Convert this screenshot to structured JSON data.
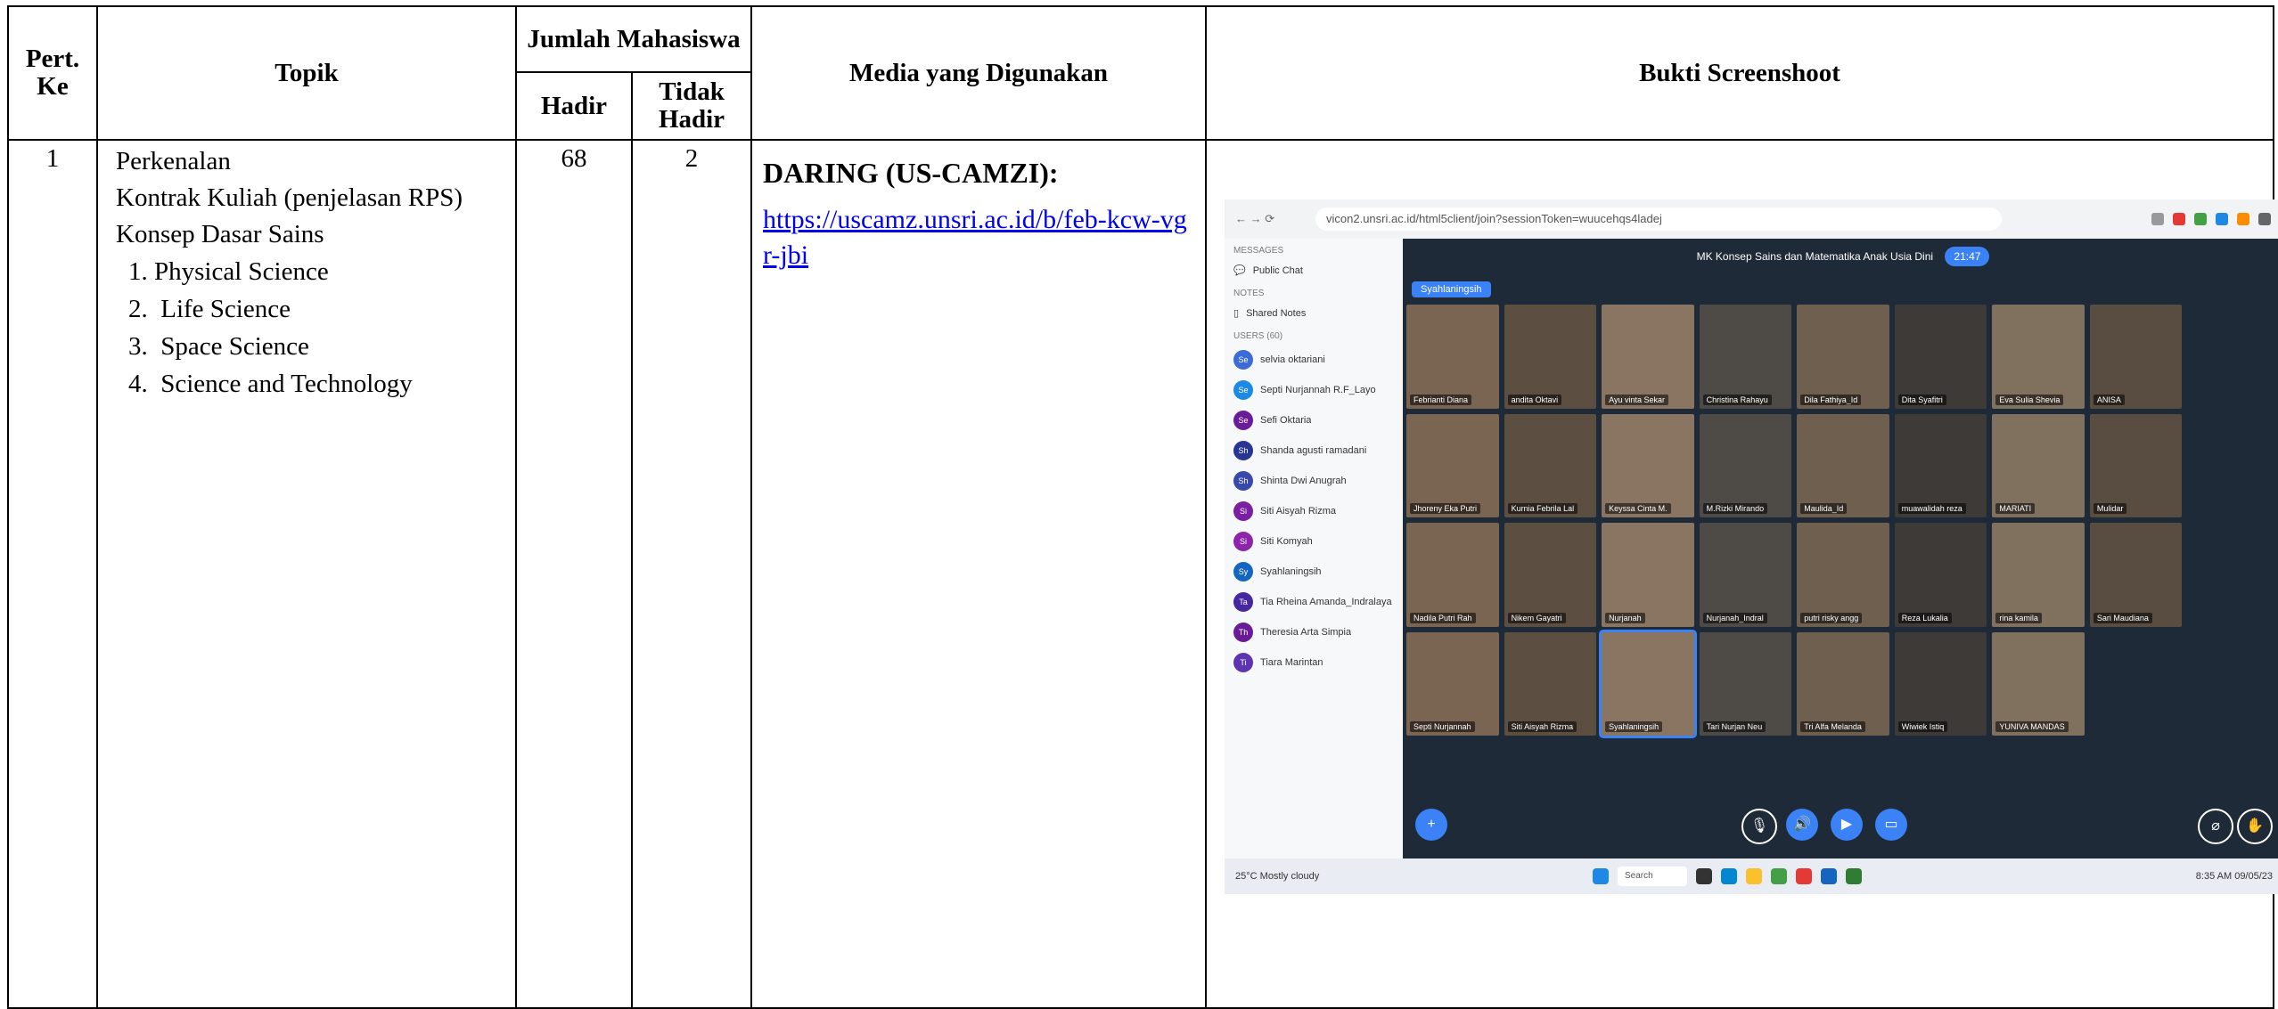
{
  "headers": {
    "pert": "Pert. Ke",
    "topik": "Topik",
    "jumlah": "Jumlah Mahasiswa",
    "hadir": "Hadir",
    "tidak_hadir": "Tidak Hadir",
    "media": "Media yang Digunakan",
    "bukti": "Bukti Screenshoot"
  },
  "rows": [
    {
      "no": "1",
      "topik_lines": [
        "Perkenalan",
        "Kontrak Kuliah (penjelasan RPS)",
        "Konsep Dasar Sains"
      ],
      "subtopics": [
        "1. Physical Science",
        "2.  Life Science",
        "3.  Space Science",
        "4.  Science and Technology"
      ],
      "hadir": "68",
      "tidak_hadir": "2",
      "media_mode": "DARING (US-CAMZI):",
      "media_link": "https://uscamz.unsri.ac.id/b/feb-kcw-vgr-jbi"
    }
  ],
  "screenshot": {
    "meeting_title": "MK Konsep Sains dan Matematika Anak Usia Dini",
    "recording": "21:47",
    "presenter": "Syahlaningsih",
    "sidebar_messages": "MESSAGES",
    "sidebar_public_chat": "Public Chat",
    "sidebar_notes": "NOTES",
    "sidebar_shared_notes": "Shared Notes",
    "sidebar_users": "USERS (60)",
    "users": [
      {
        "initials": "Se",
        "name": "selvia oktariani"
      },
      {
        "initials": "Se",
        "name": "Septi Nurjannah R.F_Layo"
      },
      {
        "initials": "Se",
        "name": "Sefi Oktaria"
      },
      {
        "initials": "Sh",
        "name": "Shanda agusti ramadani"
      },
      {
        "initials": "Sh",
        "name": "Shinta Dwi Anugrah"
      },
      {
        "initials": "Si",
        "name": "Siti Aisyah Rizma"
      },
      {
        "initials": "Si",
        "name": "Siti Komyah"
      },
      {
        "initials": "Sy",
        "name": "Syahlaningsih"
      },
      {
        "initials": "Ta",
        "name": "Tia Rheina Amanda_Indralaya"
      },
      {
        "initials": "Th",
        "name": "Theresia Arta Simpia"
      },
      {
        "initials": "Ti",
        "name": "Tiara Marintan"
      }
    ],
    "tiles": [
      "Febrianti Diana",
      "andita Oktavi",
      "Ayu vinta Sekar",
      "Christina Rahayu",
      "Dila Fathiya_Id",
      "Dita Syafitri",
      "Eva Sulia Shevia",
      "ANISA",
      "",
      "Jhoreny Eka Putri",
      "Kurnia Febrila Lal",
      "Keyssa Cinta M.",
      "M.Rizki Mirando",
      "Maulida_Id",
      "muawalidah reza",
      "MARIATI",
      "Mulidar",
      "",
      "Nadila Putri Rah",
      "Nikem Gayatri",
      "Nurjanah",
      "Nurjanah_Indral",
      "putri risky angg",
      "Reza Lukalia",
      "rina kamila",
      "Sari Maudiana",
      "",
      "Septi Nurjannah",
      "Siti Aisyah Rizma",
      "Syahlaningsih",
      "Tari Nurjan Neu",
      "Tri Alfa Melanda",
      "Wiwiek Istiq",
      "YUNIVA MANDAS",
      "",
      ""
    ],
    "browser_url": "vicon2.unsri.ac.id/html5client/join?sessionToken=wuucehqs4ladej",
    "search": "Search",
    "weather": "25°C Mostly cloudy",
    "clock": "8:35 AM 09/05/23"
  }
}
